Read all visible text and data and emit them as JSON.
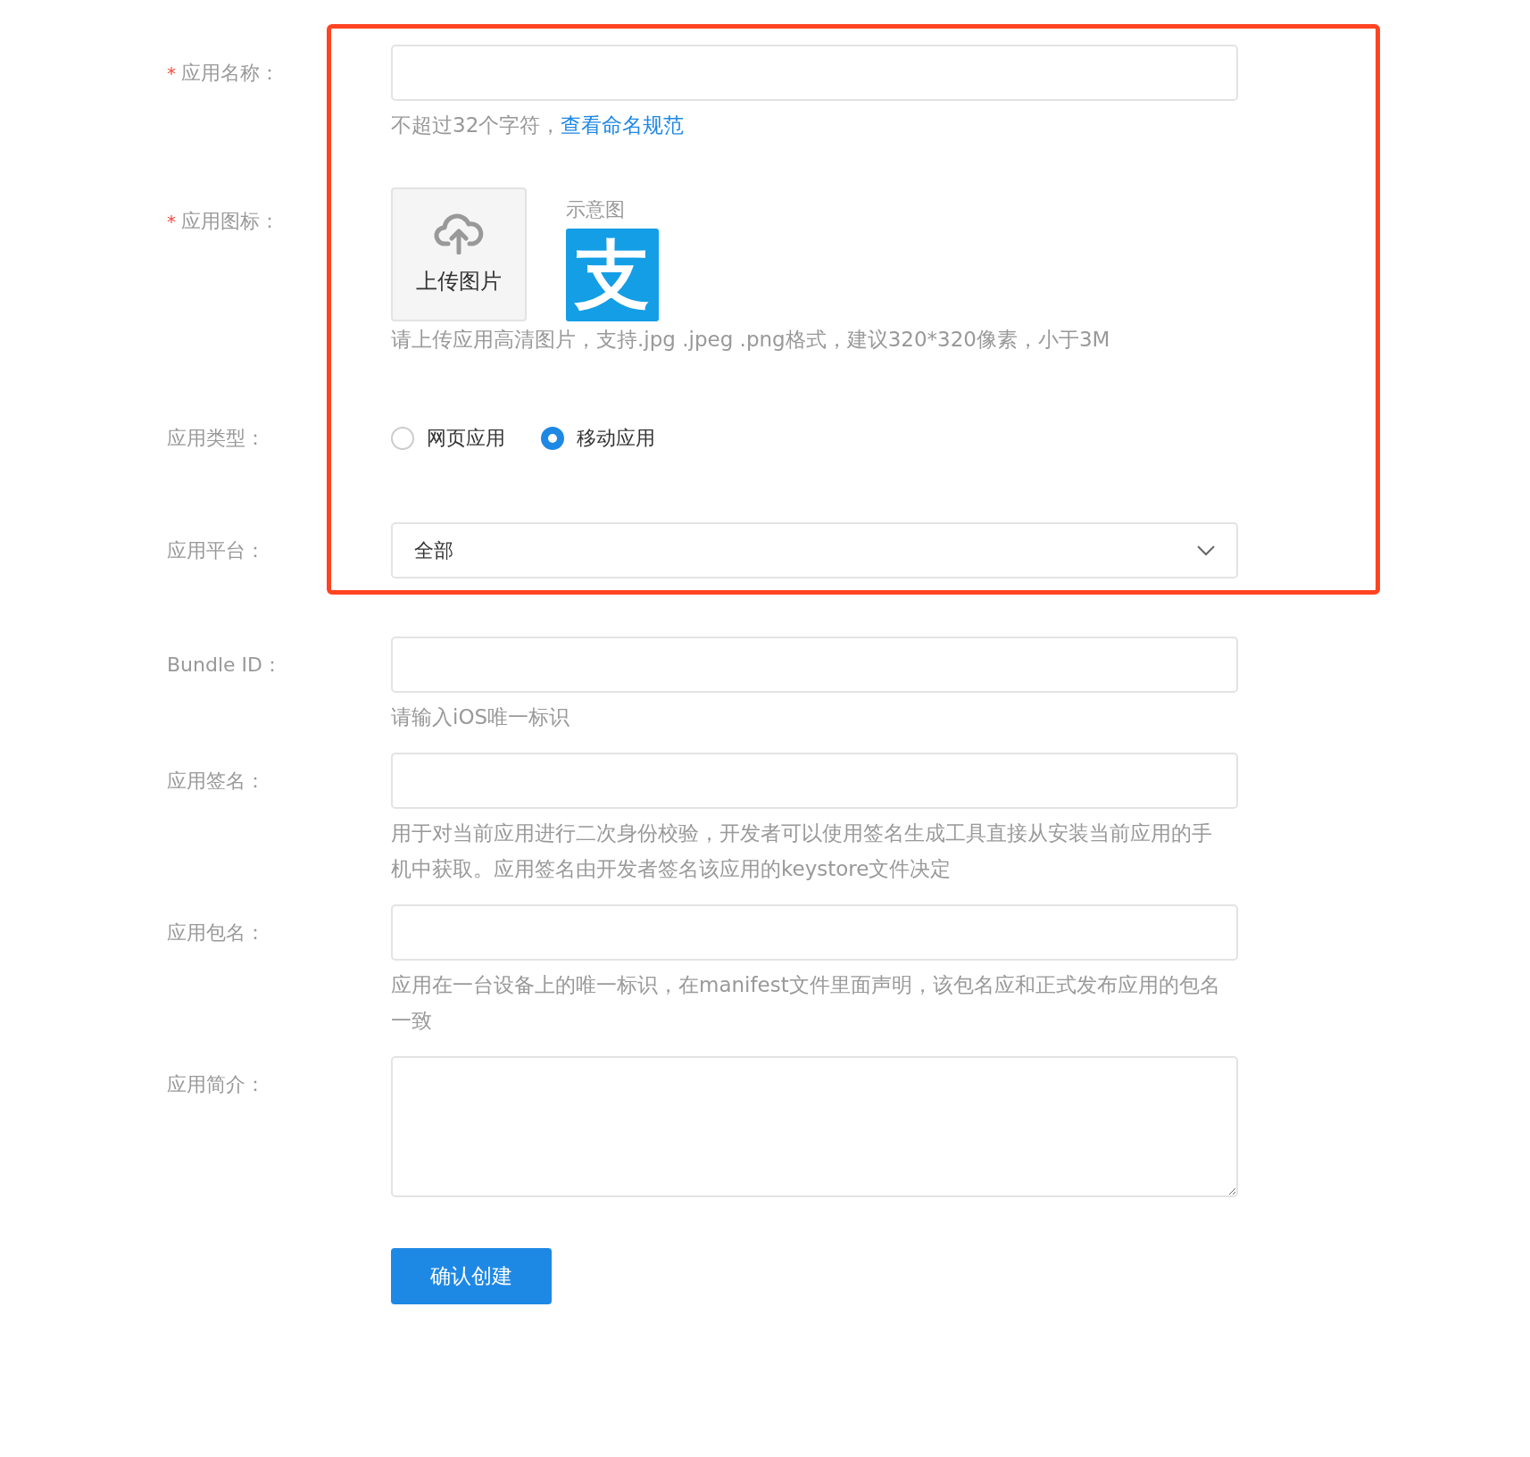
{
  "fields": [
    {
      "kind": "text",
      "label": "应用名称：",
      "required_mark": "*",
      "hint": "不超过32个字符，",
      "hint_link": "查看命名规范"
    },
    {
      "kind": "upload",
      "label": "应用图标：",
      "required_mark": "*",
      "upload_label": "上传图片",
      "sample_caption": "示意图",
      "sample_glyph": "支",
      "hint": "请上传应用高清图片，支持.jpg .jpeg .png格式，建议320*320像素，小于3M"
    },
    {
      "kind": "radio",
      "label": "应用类型：",
      "options": [
        {
          "label": "网页应用",
          "selected": false
        },
        {
          "label": "移动应用",
          "selected": true
        }
      ]
    },
    {
      "kind": "select",
      "label": "应用平台：",
      "value": "全部"
    },
    {
      "kind": "text",
      "label": "Bundle ID：",
      "hint": "请输入iOS唯一标识"
    },
    {
      "kind": "text",
      "label": "应用签名：",
      "hint": "用于对当前应用进行二次身份校验，开发者可以使用签名生成工具直接从安装当前应用的手机中获取。应用签名由开发者签名该应用的keystore文件决定"
    },
    {
      "kind": "text",
      "label": "应用包名：",
      "hint": "应用在一台设备上的唯一标识，在manifest文件里面声明，该包名应和正式发布应用的包名一致"
    },
    {
      "kind": "textarea",
      "label": "应用简介："
    }
  ],
  "submit": "确认创建"
}
